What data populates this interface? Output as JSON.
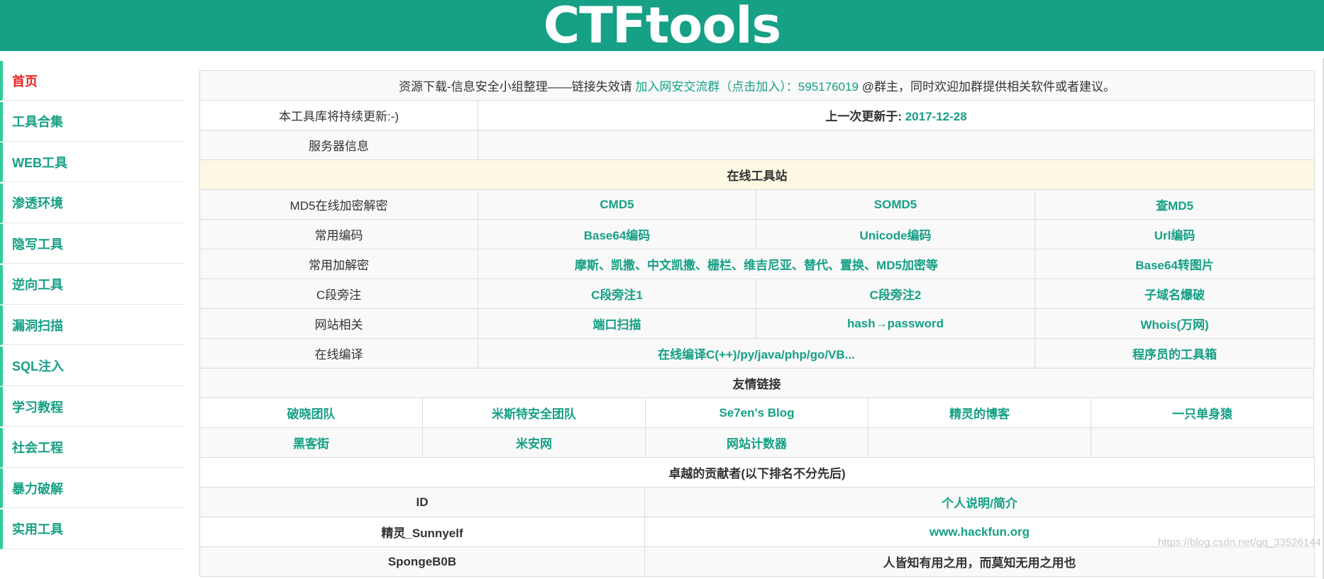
{
  "header": {
    "title": "CTFtools"
  },
  "sidebar": {
    "items": [
      {
        "label": "首页"
      },
      {
        "label": "工具合集"
      },
      {
        "label": "WEB工具"
      },
      {
        "label": "渗透环境"
      },
      {
        "label": "隐写工具"
      },
      {
        "label": "逆向工具"
      },
      {
        "label": "漏洞扫描"
      },
      {
        "label": "SQL注入"
      },
      {
        "label": "学习教程"
      },
      {
        "label": "社会工程"
      },
      {
        "label": "暴力破解"
      },
      {
        "label": "实用工具"
      }
    ]
  },
  "notice": {
    "prefix": "资源下载-信息安全小组整理——链接失效请 ",
    "link": "加入网安交流群（点击加入）：595176019",
    "suffix": " @群主，同时欢迎加群提供相关软件或者建议。"
  },
  "info": {
    "update_note": "本工具库将持续更新:-)",
    "last_update_label": "上一次更新于: ",
    "last_update_date": "2017-12-28",
    "server_label": "服务器信息"
  },
  "online": {
    "title": "在线工具站",
    "rows": [
      {
        "label": "MD5在线加密解密",
        "links": [
          "CMD5",
          "SOMD5",
          "查MD5"
        ]
      },
      {
        "label": "常用编码",
        "links": [
          "Base64编码",
          "Unicode编码",
          "Url编码"
        ]
      },
      {
        "label": "常用加解密",
        "links": [
          "摩斯、凯撒、中文凯撒、栅栏、维吉尼亚、替代、置换、MD5加密等",
          "Base64转图片"
        ]
      },
      {
        "label": "C段旁注",
        "links": [
          "C段旁注1",
          "C段旁注2",
          "子域名爆破"
        ]
      },
      {
        "label": "网站相关",
        "links": [
          "端口扫描",
          "hash→password",
          "Whois(万网)"
        ]
      },
      {
        "label": "在线编译",
        "links": [
          "在线编译C(++)/py/java/php/go/VB...",
          "程序员的工具箱"
        ]
      }
    ]
  },
  "friends": {
    "title": "友情链接",
    "row1": [
      "破晓团队",
      "米斯特安全团队",
      "Se7en's Blog",
      "精灵的博客",
      "一只单身猿"
    ],
    "row2": [
      "黑客街",
      "米安网",
      "网站计数器"
    ]
  },
  "contributors": {
    "title": "卓越的贡献者(以下排名不分先后)",
    "col_id": "ID",
    "col_desc": "个人说明/简介",
    "rows": [
      {
        "id": "精灵_Sunnyelf",
        "desc": "www.hackfun.org"
      },
      {
        "id": "SpongeB0B",
        "desc": "人皆知有用之用，而莫知无用之用也"
      }
    ]
  },
  "watermark": "https://blog.csdn.net/qq_33526144"
}
